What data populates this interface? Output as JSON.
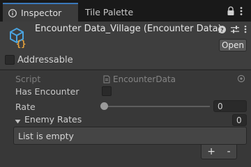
{
  "tabs": [
    {
      "label": "Inspector",
      "icon": "info-icon",
      "active": true
    },
    {
      "label": "Tile Palette",
      "active": false
    }
  ],
  "header": {
    "title": "Encounter Data_Village (Encounter Data)",
    "open_label": "Open",
    "icons": [
      "help-icon",
      "settings-sliders-icon",
      "kebab-menu-icon"
    ]
  },
  "addressable": {
    "label": "Addressable",
    "checked": false
  },
  "fields": {
    "script": {
      "label": "Script",
      "value": "EncounterData"
    },
    "has_encounter": {
      "label": "Has Encounter",
      "checked": false
    },
    "rate": {
      "label": "Rate",
      "value": "0",
      "slider_fraction": 0
    }
  },
  "enemy_rates": {
    "label": "Enemy Rates",
    "count": "0",
    "empty_text": "List is empty",
    "add_label": "+",
    "remove_label": "-"
  },
  "colors": {
    "accent": "#3a79bb",
    "asset_icon": "#4aa3df",
    "brace_icon": "#e8a33c"
  }
}
